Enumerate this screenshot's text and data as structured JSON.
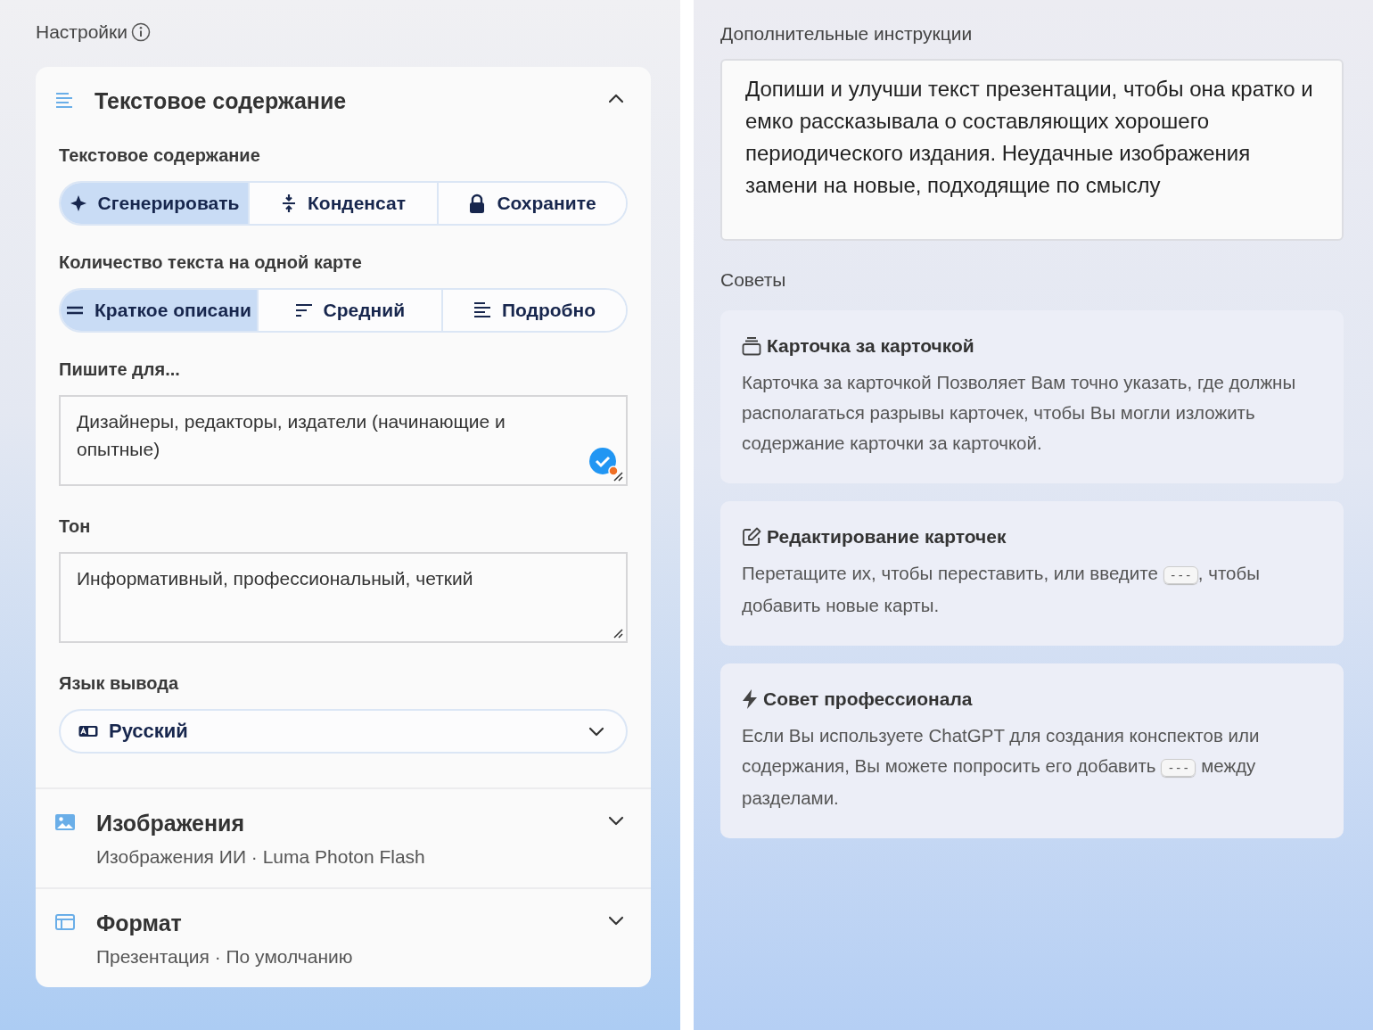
{
  "settings": {
    "title": "Настройки",
    "sections": [
      {
        "kind": "text",
        "title": "Текстовое содержание",
        "expanded": true,
        "fields": [
          {
            "kind": "segmented",
            "label": "Текстовое содержание",
            "options": [
              {
                "label": "Сгенерировать",
                "selected": true
              },
              {
                "label": "Конденсат",
                "selected": false
              },
              {
                "label": "Сохраните",
                "selected": false
              }
            ]
          },
          {
            "kind": "segmented",
            "label": "Количество текста на одной карте",
            "options": [
              {
                "label": "Краткое описани",
                "selected": true
              },
              {
                "label": "Средний",
                "selected": false
              },
              {
                "label": "Подробно",
                "selected": false
              }
            ]
          },
          {
            "kind": "textarea",
            "label": "Пишите для...",
            "value": "Дизайнеры, редакторы, издатели (начинающие и опытные)"
          },
          {
            "kind": "textarea",
            "label": "Тон",
            "value": "Информативный, профессиональный, четкий"
          },
          {
            "kind": "select",
            "label": "Язык вывода",
            "value": "Русский"
          }
        ]
      },
      {
        "kind": "images",
        "title": "Изображения",
        "subtitle": "Изображения ИИ · Luma Photon Flash",
        "expanded": false
      },
      {
        "kind": "format",
        "title": "Формат",
        "subtitle": "Презентация · По умолчанию",
        "expanded": false
      }
    ]
  },
  "instructions": {
    "label": "Дополнительные инструкции",
    "value": "Допиши и улучши текст презентации, чтобы она кратко и емко рассказывала о составляющих хорошего периодического издания. Неудачные изображения замени на новые, подходящие по смыслу"
  },
  "tips": {
    "title": "Советы",
    "items": [
      {
        "kind": "cards",
        "title": "Карточка за карточкой",
        "body": [
          {
            "kind": "text",
            "text": "Карточка за карточкой Позволяет Вам точно указать, где должны располагаться разрывы карточек, чтобы Вы могли изложить содержание карточки за карточкой."
          }
        ]
      },
      {
        "kind": "edit",
        "title": "Редактирование карточек",
        "body": [
          {
            "kind": "text",
            "text": "Перетащите их, чтобы переставить, или введите "
          },
          {
            "kind": "code",
            "text": "---"
          },
          {
            "kind": "text",
            "text": ", чтобы добавить новые карты."
          }
        ]
      },
      {
        "kind": "pro",
        "title": "Совет профессионала",
        "body": [
          {
            "kind": "text",
            "text": "Если Вы используете ChatGPT для создания конспектов или содержания, Вы можете попросить его добавить "
          },
          {
            "kind": "code",
            "text": "---"
          },
          {
            "kind": "text",
            "text": " между разделами."
          }
        ]
      }
    ]
  }
}
